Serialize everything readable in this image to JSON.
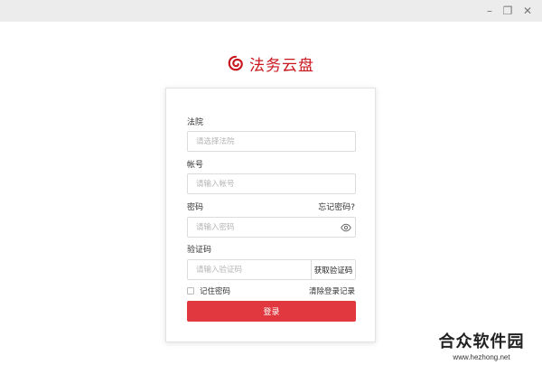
{
  "window": {
    "controls": [
      "–",
      "❐",
      "✕"
    ]
  },
  "brand": {
    "name": "法务云盘",
    "logo_icon": "swirl-logo-icon",
    "color": "#c8161d"
  },
  "form": {
    "court": {
      "label": "法院",
      "placeholder": "请选择法院"
    },
    "account": {
      "label": "帐号",
      "placeholder": "请输入帐号"
    },
    "password": {
      "label": "密码",
      "placeholder": "请输入密码",
      "forgot": "忘记密码?"
    },
    "captcha": {
      "label": "验证码",
      "placeholder": "请输入验证码",
      "get_code": "获取验证码"
    },
    "remember": "记住密码",
    "clear_records": "清除登录记录",
    "submit": "登录",
    "accent": "#e0383e"
  },
  "watermark": {
    "title": "合众软件园",
    "url": "www.hezhong.net"
  }
}
